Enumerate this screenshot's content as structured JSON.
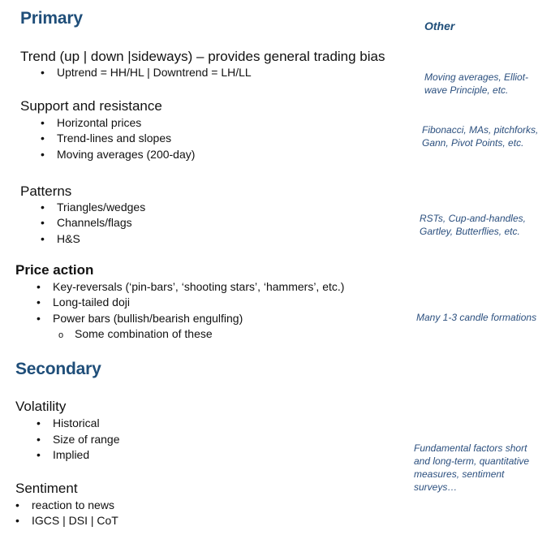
{
  "primary": {
    "title": "Primary",
    "other_title": "Other",
    "trend": {
      "heading": "Trend (up | down |sideways) – provides general trading bias",
      "items": [
        "Uptrend = HH/HL | Downtrend = LH/LL"
      ],
      "note": [
        "Moving averages, Elliot-",
        "wave Principle, etc."
      ]
    },
    "support": {
      "heading": "Support and resistance",
      "items": [
        "Horizontal prices",
        "Trend-lines and slopes",
        "Moving averages (200-day)"
      ],
      "note": [
        "Fibonacci, MAs, pitchforks,",
        "Gann, Pivot Points, etc."
      ]
    },
    "patterns": {
      "heading": "Patterns",
      "items": [
        "Triangles/wedges",
        "Channels/flags",
        "H&S"
      ],
      "note": [
        "RSTs, Cup-and-handles,",
        "Gartley, Butterflies, etc."
      ]
    },
    "price_action": {
      "heading": "Price action",
      "items": [
        "Key-reversals (‘pin-bars’, ‘shooting stars’, ‘hammers’, etc.)",
        "Long-tailed doji",
        "Power bars (bullish/bearish engulfing)"
      ],
      "subitems": [
        "Some combination of these"
      ],
      "note": "Many 1-3 candle formations"
    }
  },
  "secondary": {
    "title": "Secondary",
    "volatility": {
      "heading": "Volatility",
      "items": [
        "Historical",
        "Size of range",
        "Implied"
      ]
    },
    "sentiment": {
      "heading": "Sentiment",
      "items": [
        "reaction to news",
        "IGCS | DSI | CoT"
      ]
    },
    "note": [
      "Fundamental factors short",
      "and long-term, quantitative",
      "measures, sentiment",
      "surveys…"
    ]
  },
  "glyphs": {
    "bullet": "•",
    "sub_bullet": "o"
  }
}
